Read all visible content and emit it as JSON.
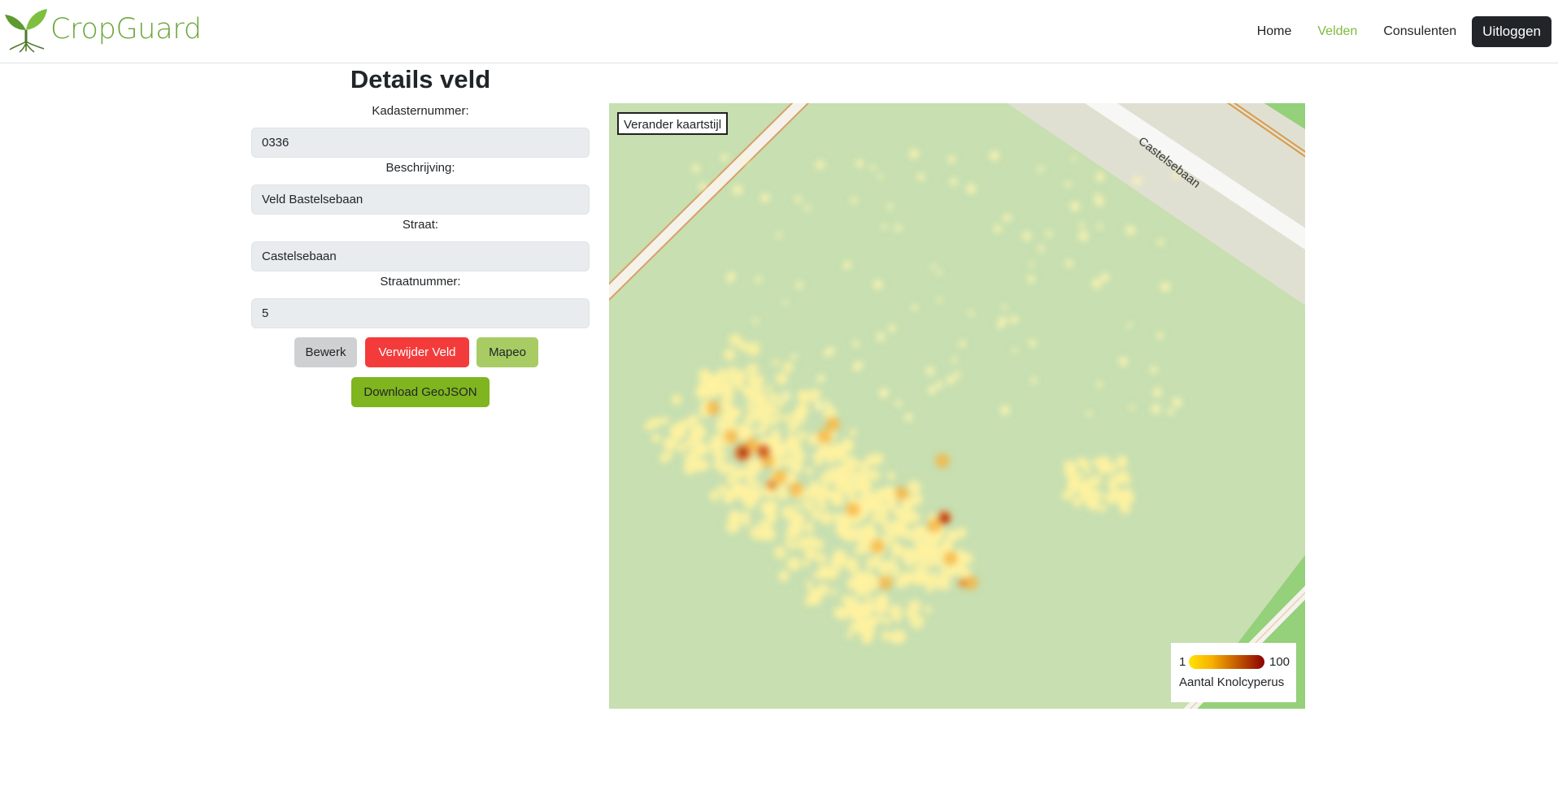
{
  "app": {
    "brand": "CropGuard",
    "brand_color": "#6aa63a"
  },
  "nav": {
    "items": [
      {
        "label": "Home",
        "active": false
      },
      {
        "label": "Velden",
        "active": true
      },
      {
        "label": "Consulenten",
        "active": false
      }
    ],
    "logout_label": "Uitloggen"
  },
  "details": {
    "title": "Details veld",
    "fields": [
      {
        "label": "Kadasternummer:",
        "value": "0336"
      },
      {
        "label": "Beschrijving:",
        "value": "Veld Bastelsebaan"
      },
      {
        "label": "Straat:",
        "value": "Castelsebaan"
      },
      {
        "label": "Straatnummer:",
        "value": "5"
      }
    ],
    "buttons": {
      "edit": "Bewerk",
      "delete": "Verwijder Veld",
      "mapeo": "Mapeo",
      "download": "Download GeoJSON"
    }
  },
  "map": {
    "style_button": "Verander kaartstijl",
    "road_label": "Castelsebaan",
    "legend": {
      "min": "1",
      "max": "100",
      "title": "Aantal Knolcyperus",
      "gradient_colors": [
        "#ffe400",
        "#f8b100",
        "#c96400",
        "#8b0000"
      ]
    },
    "colors": {
      "field": "#c7dfb1",
      "road": "#e0e0d2",
      "grass": "#95d07a"
    }
  }
}
